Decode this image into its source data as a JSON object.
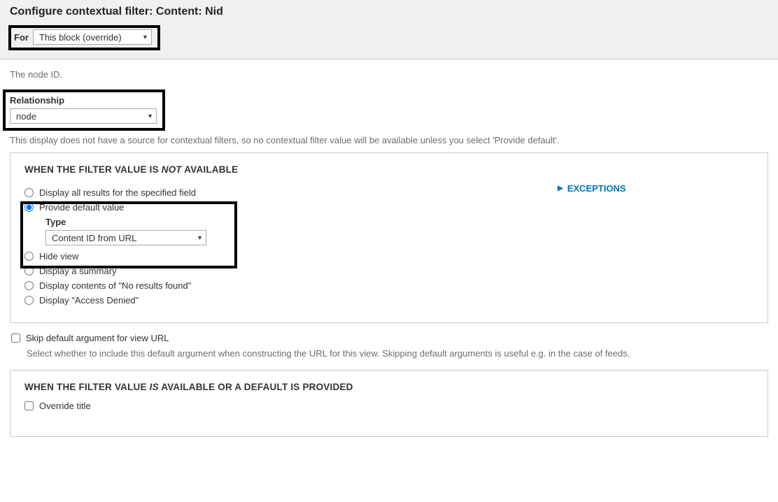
{
  "header": {
    "title": "Configure contextual filter: Content: Nid",
    "for_label": "For",
    "for_select": "This block (override)"
  },
  "description": "The node ID.",
  "relationship": {
    "label": "Relationship",
    "value": "node"
  },
  "note": "This display does not have a source for contextual filters, so no contextual filter value will be available unless you select 'Provide default'.",
  "fieldset_not": {
    "legend_pre": "WHEN THE FILTER VALUE IS ",
    "legend_em": "NOT",
    "legend_post": " AVAILABLE",
    "radios": {
      "display_all": "Display all results for the specified field",
      "provide_default": "Provide default value",
      "hide_view": "Hide view",
      "display_summary": "Display a summary",
      "no_results": "Display contents of \"No results found\"",
      "access_denied": "Display \"Access Denied\""
    },
    "type_label": "Type",
    "type_value": "Content ID from URL",
    "exceptions": "EXCEPTIONS"
  },
  "skip": {
    "label": "Skip default argument for view URL",
    "desc": "Select whether to include this default argument when constructing the URL for this view. Skipping default arguments is useful e.g. in the case of feeds."
  },
  "fieldset_is": {
    "legend_pre": "WHEN THE FILTER VALUE ",
    "legend_em": "IS",
    "legend_post": " AVAILABLE OR A DEFAULT IS PROVIDED",
    "override_title": "Override title"
  }
}
